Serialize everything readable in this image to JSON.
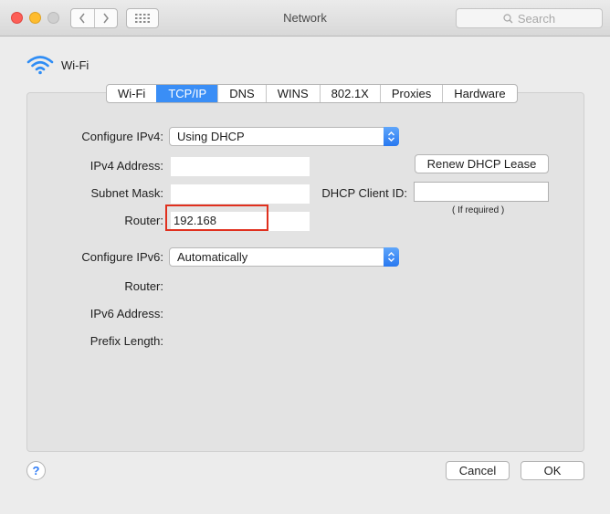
{
  "window": {
    "title": "Network",
    "search_placeholder": "Search"
  },
  "interface": {
    "name": "Wi-Fi",
    "icon": "wifi-icon"
  },
  "tabs": [
    {
      "label": "Wi-Fi",
      "active": false
    },
    {
      "label": "TCP/IP",
      "active": true
    },
    {
      "label": "DNS",
      "active": false
    },
    {
      "label": "WINS",
      "active": false
    },
    {
      "label": "802.1X",
      "active": false
    },
    {
      "label": "Proxies",
      "active": false
    },
    {
      "label": "Hardware",
      "active": false
    }
  ],
  "ipv4": {
    "configure_label": "Configure IPv4:",
    "configure_value": "Using DHCP",
    "address_label": "IPv4 Address:",
    "address_value": "",
    "subnet_label": "Subnet Mask:",
    "subnet_value": "",
    "router_label": "Router:",
    "router_value": "192.168"
  },
  "dhcp": {
    "renew_label": "Renew DHCP Lease",
    "client_id_label": "DHCP Client ID:",
    "client_id_value": "",
    "client_id_hint": "( If required )"
  },
  "ipv6": {
    "configure_label": "Configure IPv6:",
    "configure_value": "Automatically",
    "router_label": "Router:",
    "address_label": "IPv6 Address:",
    "prefix_label": "Prefix Length:"
  },
  "footer": {
    "help_label": "?",
    "cancel_label": "Cancel",
    "ok_label": "OK"
  },
  "colors": {
    "accent": "#3a8ef6",
    "highlight_box": "#e0301e"
  }
}
